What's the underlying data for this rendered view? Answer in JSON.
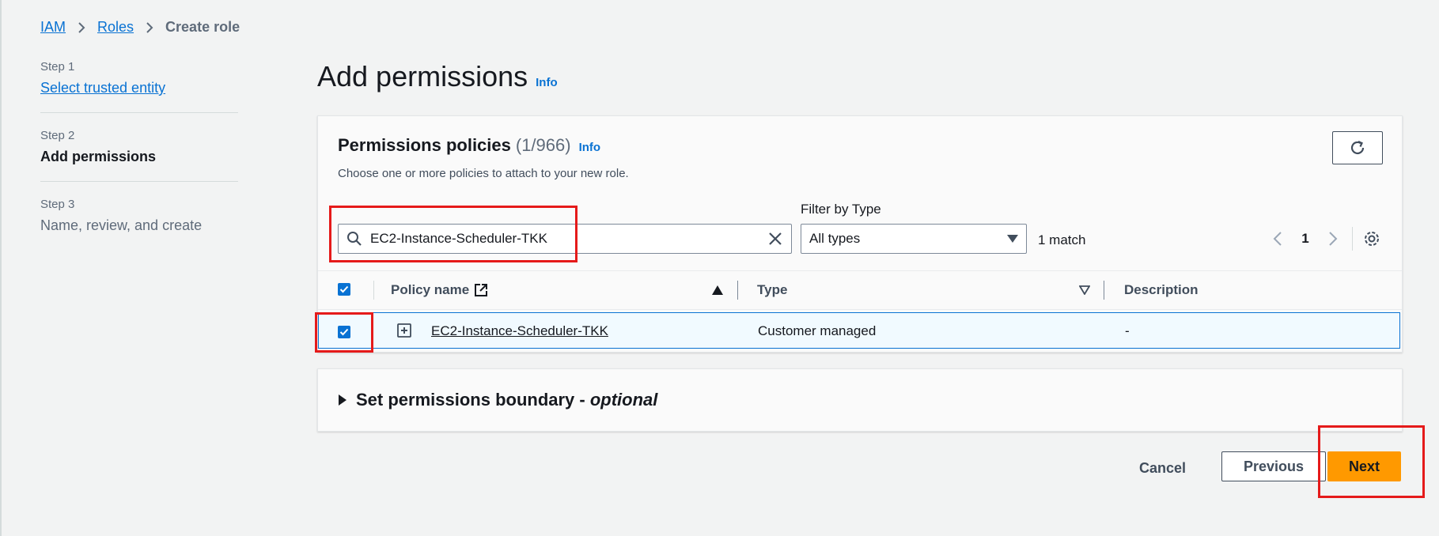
{
  "breadcrumb": {
    "items": [
      "IAM",
      "Roles"
    ],
    "current": "Create role"
  },
  "steps": [
    {
      "label": "Step 1",
      "title": "Select trusted entity"
    },
    {
      "label": "Step 2",
      "title": "Add permissions"
    },
    {
      "label": "Step 3",
      "title": "Name, review, and create"
    }
  ],
  "page": {
    "title": "Add permissions",
    "info": "Info"
  },
  "policies": {
    "title": "Permissions policies",
    "count": "(1/966)",
    "info": "Info",
    "description": "Choose one or more policies to attach to your new role.",
    "search_value": "EC2-Instance-Scheduler-TKK",
    "filter_label": "Filter by Type",
    "filter_value": "All types",
    "match_count": "1 match",
    "page_number": "1",
    "columns": [
      "Policy name",
      "Type",
      "Description"
    ],
    "rows": [
      {
        "name": "EC2-Instance-Scheduler-TKK",
        "type": "Customer managed",
        "description": "-",
        "selected": true
      }
    ]
  },
  "boundary": {
    "title": "Set permissions boundary - ",
    "optional": "optional"
  },
  "footer": {
    "cancel": "Cancel",
    "previous": "Previous",
    "next": "Next"
  },
  "colors": {
    "accent": "#0972d3",
    "primary_button": "#ff9900",
    "highlight": "#e51a1a"
  },
  "icons": [
    "chevron-right-icon",
    "refresh-icon",
    "search-icon",
    "clear-icon",
    "caret-down-icon",
    "chevron-left-icon",
    "settings-icon",
    "external-link-icon",
    "sort-asc-icon",
    "sort-icon",
    "expand-icon",
    "checkbox-check-icon",
    "caret-right-icon"
  ]
}
